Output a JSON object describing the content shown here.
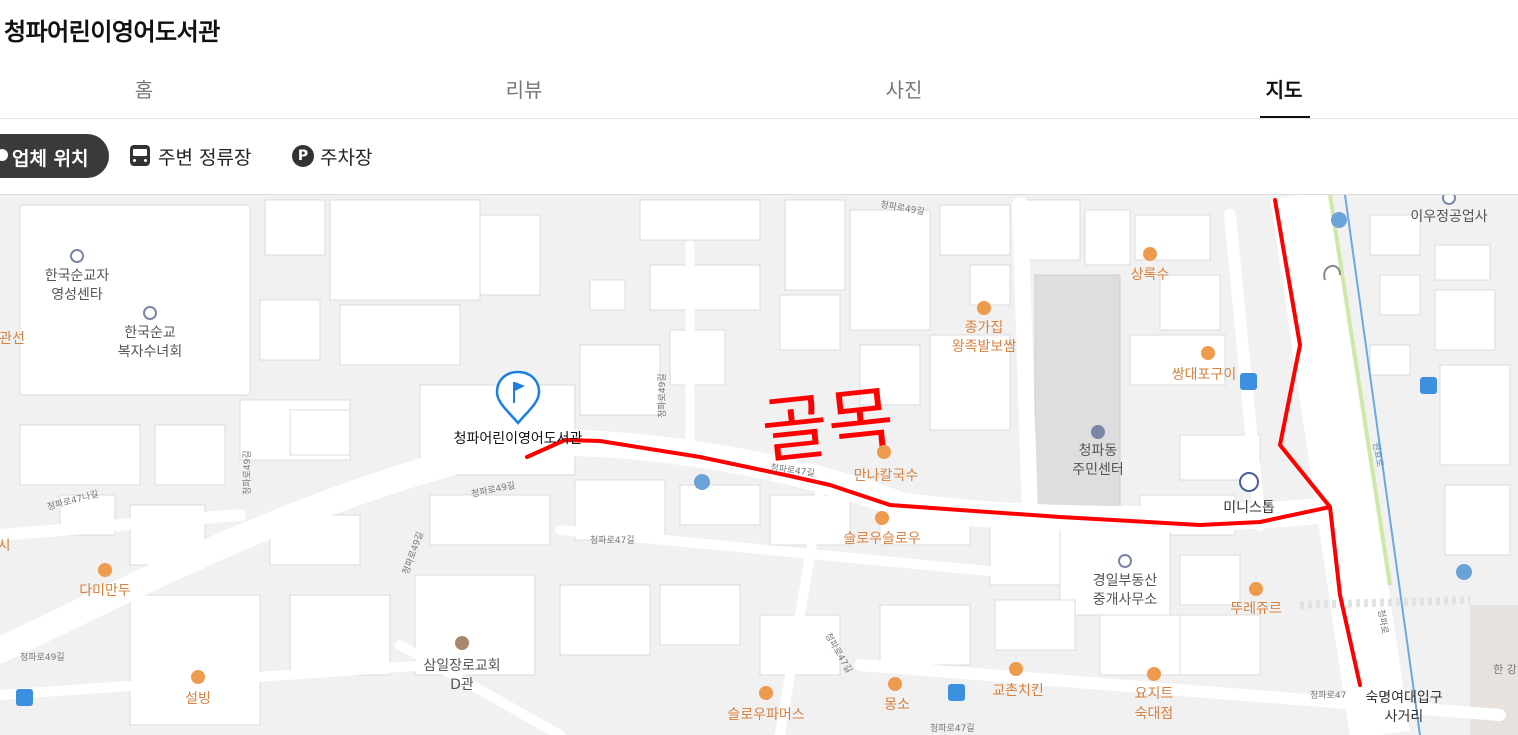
{
  "place": {
    "title": "청파어린이영어도서관"
  },
  "tabs": [
    {
      "label": "홈",
      "active": false
    },
    {
      "label": "리뷰",
      "active": false
    },
    {
      "label": "사진",
      "active": false
    },
    {
      "label": "지도",
      "active": true
    }
  ],
  "filters": {
    "location": "업체 위치",
    "bus_stops": "주변 정류장",
    "parking": "주차장",
    "parking_icon": "P"
  },
  "map": {
    "annotation_handwritten": "골목",
    "marker_label": "청파어린이영어도서관",
    "route_color": "#ff0000",
    "pois": [
      {
        "key": "p1",
        "name": "한국순교자영성센타",
        "lines": [
          "한국순교자",
          "영성센타"
        ],
        "type": "place"
      },
      {
        "key": "p2",
        "name": "한국순교복자수녀회",
        "lines": [
          "한국순교",
          "복자수녀회"
        ],
        "type": "place"
      },
      {
        "key": "p3",
        "name": "관선",
        "lines": [
          "관선"
        ],
        "type": "restaurant"
      },
      {
        "key": "p4",
        "name": "상록수",
        "lines": [
          "상록수"
        ],
        "type": "restaurant"
      },
      {
        "key": "p5",
        "name": "종가집 왕족발보쌈",
        "lines": [
          "종가집",
          "왕족발보쌈"
        ],
        "type": "restaurant"
      },
      {
        "key": "p6",
        "name": "쌍대포구이",
        "lines": [
          "쌍대포구이"
        ],
        "type": "restaurant"
      },
      {
        "key": "p7",
        "name": "청파동주민센터",
        "lines": [
          "청파동",
          "주민센터"
        ],
        "type": "public"
      },
      {
        "key": "p8",
        "name": "만나칼국수",
        "lines": [
          "만나칼국수"
        ],
        "type": "restaurant"
      },
      {
        "key": "p9",
        "name": "미니스톱",
        "lines": [
          "미니스톱"
        ],
        "type": "store"
      },
      {
        "key": "p10",
        "name": "슬로우슬로우",
        "lines": [
          "슬로우슬로우"
        ],
        "type": "cafe"
      },
      {
        "key": "p11",
        "name": "경일부동산중개사무소",
        "lines": [
          "경일부동산",
          "중개사무소"
        ],
        "type": "place"
      },
      {
        "key": "p12",
        "name": "뚜레쥬르",
        "lines": [
          "뚜레쥬르"
        ],
        "type": "restaurant"
      },
      {
        "key": "p13",
        "name": "다미만두",
        "lines": [
          "다미만두"
        ],
        "type": "restaurant"
      },
      {
        "key": "p14",
        "name": "삼일장로교회 D관",
        "lines": [
          "삼일장로교회",
          "D관"
        ],
        "type": "church"
      },
      {
        "key": "p15",
        "name": "설빙",
        "lines": [
          "설빙"
        ],
        "type": "restaurant"
      },
      {
        "key": "p16",
        "name": "교촌치킨",
        "lines": [
          "교촌치킨"
        ],
        "type": "restaurant"
      },
      {
        "key": "p17",
        "name": "몽소",
        "lines": [
          "몽소"
        ],
        "type": "restaurant"
      },
      {
        "key": "p18",
        "name": "요지트숙대점",
        "lines": [
          "요지트",
          "숙대점"
        ],
        "type": "cafe"
      },
      {
        "key": "p19",
        "name": "슬로우파머스",
        "lines": [
          "슬로우파머스"
        ],
        "type": "restaurant"
      },
      {
        "key": "p20",
        "name": "숙명여대입구사거리",
        "lines": [
          "숙명여대입구",
          "사거리"
        ],
        "type": "intersection"
      },
      {
        "key": "p21",
        "name": "이우정공업사",
        "lines": [
          "이우정공업사"
        ],
        "type": "place"
      },
      {
        "key": "p22",
        "name": "시",
        "lines": [
          "시"
        ],
        "type": "restaurant"
      },
      {
        "key": "p23",
        "name": "한강",
        "lines": [
          "한 강"
        ],
        "type": "place"
      }
    ],
    "road_labels": [
      {
        "key": "r1",
        "text": "청파로49길"
      },
      {
        "key": "r2",
        "text": "청파로49길"
      },
      {
        "key": "r3",
        "text": "청파로47나길"
      },
      {
        "key": "r4",
        "text": "청파로47길"
      },
      {
        "key": "r5",
        "text": "청파로49길"
      },
      {
        "key": "r6",
        "text": "청파로47길"
      },
      {
        "key": "r7",
        "text": "청파로47길"
      },
      {
        "key": "r8",
        "text": "청파로49길"
      },
      {
        "key": "r9",
        "text": "청파로"
      },
      {
        "key": "r10",
        "text": "청파로47"
      },
      {
        "key": "r11",
        "text": "청파로47길"
      },
      {
        "key": "r12",
        "text": "청파로49길"
      },
      {
        "key": "r13",
        "text": "청파로49길"
      },
      {
        "key": "r14",
        "text": "원효로"
      }
    ]
  }
}
